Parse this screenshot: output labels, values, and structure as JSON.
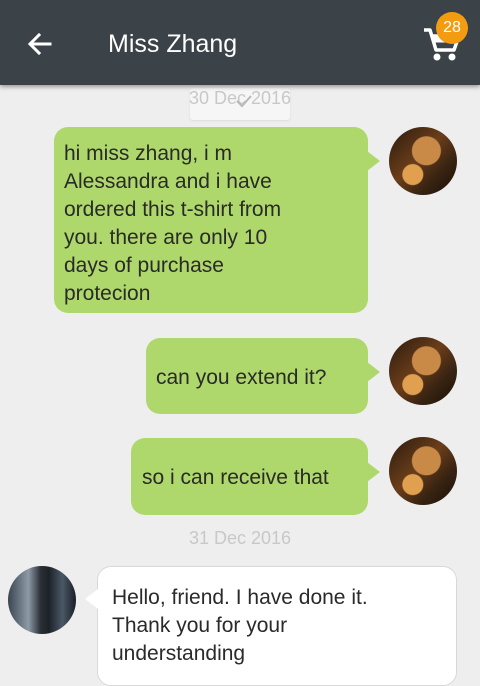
{
  "header": {
    "title": "Miss Zhang",
    "cart_badge": "28"
  },
  "dates": [
    "30 Dec 2016",
    "31 Dec 2016"
  ],
  "messages": [
    {
      "sender": "me",
      "text": "hi miss zhang,  i m\nAlessandra and i have\nordered this t-shirt from\nyou.  there are only 10\ndays of purchase\nprotecion"
    },
    {
      "sender": "me",
      "text": "can you extend it?"
    },
    {
      "sender": "me",
      "text": "so i can receive that"
    },
    {
      "sender": "friend",
      "text": "Hello, friend. I have done it.\nThank you for your\nunderstanding"
    }
  ],
  "colors": {
    "header_bg": "#3b4248",
    "my_bubble": "#aed86c",
    "friend_bubble": "#ffffff",
    "badge": "#f39c12",
    "background": "#eeeeee"
  },
  "icons": [
    "back-arrow-icon",
    "cart-icon",
    "checkmark-icon"
  ]
}
